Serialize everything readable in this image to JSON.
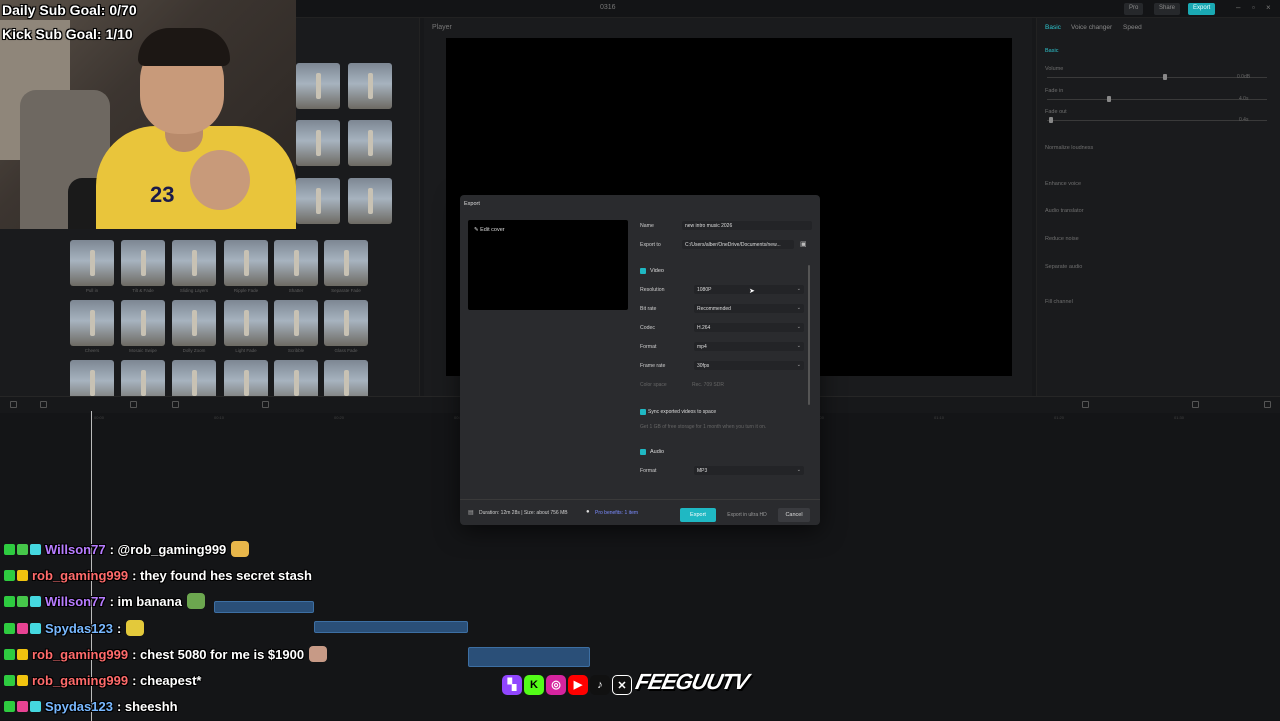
{
  "editor": {
    "window_title": "0316",
    "top_buttons": [
      "Pro",
      "Share",
      "Export"
    ],
    "player_label": "Player",
    "right_tabs": [
      "Basic",
      "Voice changer",
      "Speed"
    ],
    "right_rows": [
      "Basic",
      "Volume",
      "Fade in",
      "Fade out",
      "Normalize loudness",
      "Enhance voice",
      "Audio translator",
      "Reduce noise",
      "Separate audio",
      "Fill channel"
    ],
    "right_values": [
      "0.0dB",
      "4.0s",
      "0.4s"
    ],
    "effect_thumbs": [
      "Pull in",
      "Tilt & Fade",
      "Sliding Layers",
      "Ripple Fade",
      "Shatter",
      "Separate Fade",
      "Cheers",
      "Mosaic Swipe",
      "Dolly Zoom",
      "Light Fade",
      "Scribble",
      "Glass Fade"
    ],
    "timeline_ticks": [
      "00:00",
      "00:10",
      "00:20",
      "00:30",
      "00:40",
      "00:50",
      "01:00",
      "01:10",
      "01:20",
      "01:30"
    ]
  },
  "webcam": {
    "jersey_number": "23"
  },
  "overlay": {
    "daily_goal": "Daily Sub Goal: 0/70",
    "kick_goal": "Kick Sub Goal: 1/10"
  },
  "export_dialog": {
    "title": "Export",
    "edit_cover": "Edit cover",
    "name_label": "Name",
    "name_value": "new intro music 2026",
    "export_to_label": "Export to",
    "export_to_value": "C:/Users/alber/OneDrive/Documents/new...",
    "video_section": "Video",
    "resolution_label": "Resolution",
    "resolution_value": "1080P",
    "bitrate_label": "Bit rate",
    "bitrate_value": "Recommended",
    "codec_label": "Codec",
    "codec_value": "H.264",
    "format_label": "Format",
    "format_value": "mp4",
    "framerate_label": "Frame rate",
    "framerate_value": "30fps",
    "colorspace_label": "Color space",
    "colorspace_value": "Rec. 709 SDR",
    "sync_label": "Sync exported videos to space",
    "sync_hint": "Get 1 GB of free storage for 1 month when you turn it on.",
    "audio_section": "Audio",
    "audio_format_label": "Format",
    "audio_format_value": "MP3",
    "duration_text": "Duration: 12m 28s | Size: about 756 MB",
    "pro_benefits": "Pro benefits: 1 item",
    "export_button": "Export",
    "ultra_hd_button": "Export in ultra HD",
    "cancel_button": "Cancel",
    "accent": "#1fb8c3"
  },
  "chat": [
    {
      "user": "Willson77",
      "color": "#b77cff",
      "message": ": @rob_gaming999",
      "emote": true,
      "badges": [
        "#2ecc40",
        "#46c74a",
        "#45d8e0"
      ]
    },
    {
      "user": "rob_gaming999",
      "color": "#ff6b6b",
      "message": ": they found hes secret stash",
      "emote": false,
      "badges": [
        "#2ecc40",
        "#f1c40f"
      ]
    },
    {
      "user": "Willson77",
      "color": "#b77cff",
      "message": ": im banana",
      "emote": true,
      "badges": [
        "#2ecc40",
        "#46c74a",
        "#45d8e0"
      ]
    },
    {
      "user": "Spydas123",
      "color": "#78b8ff",
      "message": ": ",
      "emote": true,
      "badges": [
        "#2ecc40",
        "#e84393",
        "#45d8e0"
      ]
    },
    {
      "user": "rob_gaming999",
      "color": "#ff6b6b",
      "message": ": chest 5080 for me is $1900",
      "emote": true,
      "badges": [
        "#2ecc40",
        "#f1c40f"
      ]
    },
    {
      "user": "rob_gaming999",
      "color": "#ff6b6b",
      "message": ": cheapest*",
      "emote": false,
      "badges": [
        "#2ecc40",
        "#f1c40f"
      ]
    },
    {
      "user": "Spydas123",
      "color": "#78b8ff",
      "message": ": sheeshh",
      "emote": false,
      "badges": [
        "#2ecc40",
        "#e84393",
        "#45d8e0"
      ]
    }
  ],
  "socials": {
    "icons": [
      "twitch-icon",
      "kick-icon",
      "instagram-icon",
      "youtube-icon",
      "tiktok-icon",
      "x-icon"
    ],
    "handle": "FEEGUUTV"
  }
}
